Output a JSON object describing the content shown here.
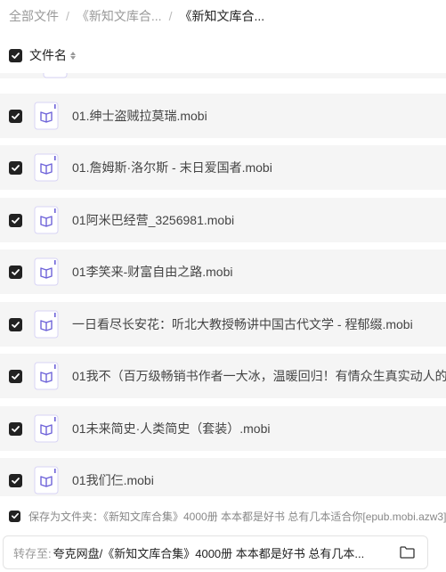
{
  "breadcrumb": [
    {
      "label": "全部文件"
    },
    {
      "label": "《新知文库合..."
    },
    {
      "label": "《新知文库合..."
    }
  ],
  "breadcrumb_separator": "/",
  "header": {
    "column_label": "文件名"
  },
  "files": [
    {
      "name": "01.绅士盗贼拉莫瑞.mobi"
    },
    {
      "name": "01.詹姆斯·洛尔斯 - 末日爱国者.mobi"
    },
    {
      "name": "01阿米巴经营_3256981.mobi"
    },
    {
      "name": "01李笑来-财富自由之路.mobi"
    },
    {
      "name": "一日看尽长安花：听北大教授畅讲中国古代文学 - 程郁缀.mobi"
    },
    {
      "name": "01我不（百万级畅销书作者一大冰，温暖回归！有情众生真实动人的故事"
    },
    {
      "name": "01未来简史·人类简史（套装）.mobi"
    },
    {
      "name": "01我们仨.mobi"
    }
  ],
  "save_as_folder": {
    "text": "保存为文件夹：《新知文库合集》4000册 本本都是好书 总有几本适合你[epub.mobi.azw3]"
  },
  "transfer": {
    "label": "转存至:",
    "path": "夸克网盘/《新知文库合集》4000册 本本都是好书 总有几本..."
  },
  "colors": {
    "accent": "#6e63d9",
    "row_bg": "#f5f5f5",
    "checkbox": "#222222"
  }
}
